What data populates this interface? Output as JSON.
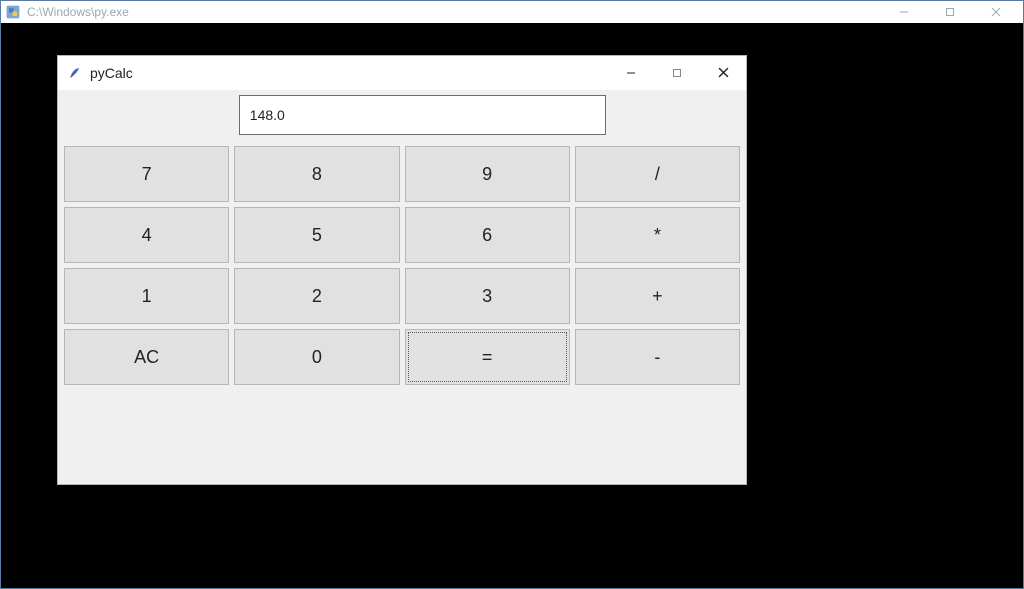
{
  "outer": {
    "title": "C:\\Windows\\py.exe"
  },
  "inner": {
    "title": "pyCalc",
    "display_value": "148.0",
    "buttons": {
      "b7": "7",
      "b8": "8",
      "b9": "9",
      "bdiv": "/",
      "b4": "4",
      "b5": "5",
      "b6": "6",
      "bmul": "*",
      "b1": "1",
      "b2": "2",
      "b3": "3",
      "badd": "+",
      "bac": "AC",
      "b0": "0",
      "beq": "=",
      "bsub": "-"
    }
  }
}
